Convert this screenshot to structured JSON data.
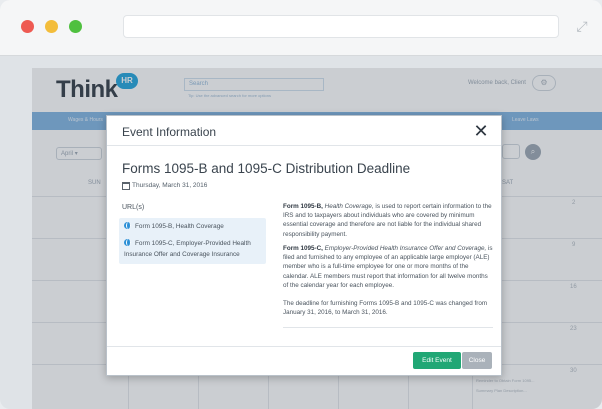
{
  "browser": {
    "url": "",
    "colors": {
      "red": "#ee5a52",
      "yellow": "#f3bd3b",
      "green": "#4fc03f"
    }
  },
  "app": {
    "logo_text": "Think",
    "logo_badge": "HR",
    "search_placeholder": "Search",
    "search_hint": "Tip: Use the advanced search for more options",
    "welcome_text": "Welcome back, Client",
    "nav_items": [
      "Wages & Hours",
      "Leave Laws"
    ],
    "month_select": "April",
    "weekdays": [
      "SUN",
      "SAT"
    ],
    "day_numbers": [
      "2",
      "9",
      "16",
      "23",
      "30"
    ],
    "day_events": [
      "Reminder to Obtain Form 1095...",
      "Summary Plan Description..."
    ],
    "accent_color": "#7fb3e1"
  },
  "modal": {
    "title": "Event Information",
    "close_label": "✕",
    "event_title": "Forms 1095-B and 1095-C Distribution Deadline",
    "event_date": "Thursday, March 31, 2016",
    "url_heading": "URL(s)",
    "urls": [
      "Form 1095-B, Health Coverage",
      "Form 1095-C, Employer-Provided Health Insurance Offer and Coverage Insurance"
    ],
    "paragraphs": [
      {
        "bold": "Form 1095-B,",
        "italic": "Health Coverage,",
        "text": "is used to report certain information to the IRS and to taxpayers about individuals who are covered by minimum essential coverage and therefore are not liable for the individual shared responsibility payment."
      },
      {
        "bold": "Form 1095-C,",
        "italic": "Employer-Provided Health Insurance Offer and Coverage,",
        "text": "is filed and furnished to any employee of an applicable large employer (ALE) member who is a full-time employee for one or more months of the calendar. ALE members must report that information for all twelve months of the calendar year for each employee."
      },
      {
        "bold": "",
        "italic": "",
        "text": "The deadline for furnishing Forms 1095-B and 1095-C was changed from January 31, 2016, to March 31, 2016."
      }
    ],
    "edit_button": "Edit Event",
    "close_button": "Close",
    "edit_color": "#21a775"
  }
}
